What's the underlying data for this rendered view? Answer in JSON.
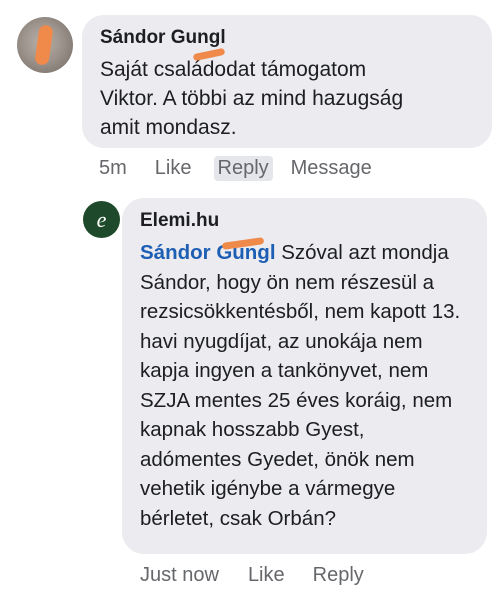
{
  "comment": {
    "author": "Sándor Gungl",
    "text": "Saját családodat támogatom\nViktor. A többi az mind hazugság\namit mondasz.",
    "time": "5m",
    "like_label": "Like",
    "reply_label": "Reply",
    "message_label": "Message"
  },
  "reply": {
    "author": "Elemi.hu",
    "avatar_letter": "e",
    "mention": "Sándor Gungl",
    "text": "Szóval azt mondja Sándor, hogy ön nem részesül a rezsicsökkentésből, nem kapott 13. havi nyugdíjat, az unokája nem kapja ingyen a tankönyvet, nem SZJA mentes 25 éves koráig, nem kapnak hosszabb Gyest, adómentes Gyedet, önök nem vehetik igénybe a vármegye bérletet, csak Orbán?",
    "time": "Just now",
    "like_label": "Like",
    "reply_label": "Reply"
  }
}
